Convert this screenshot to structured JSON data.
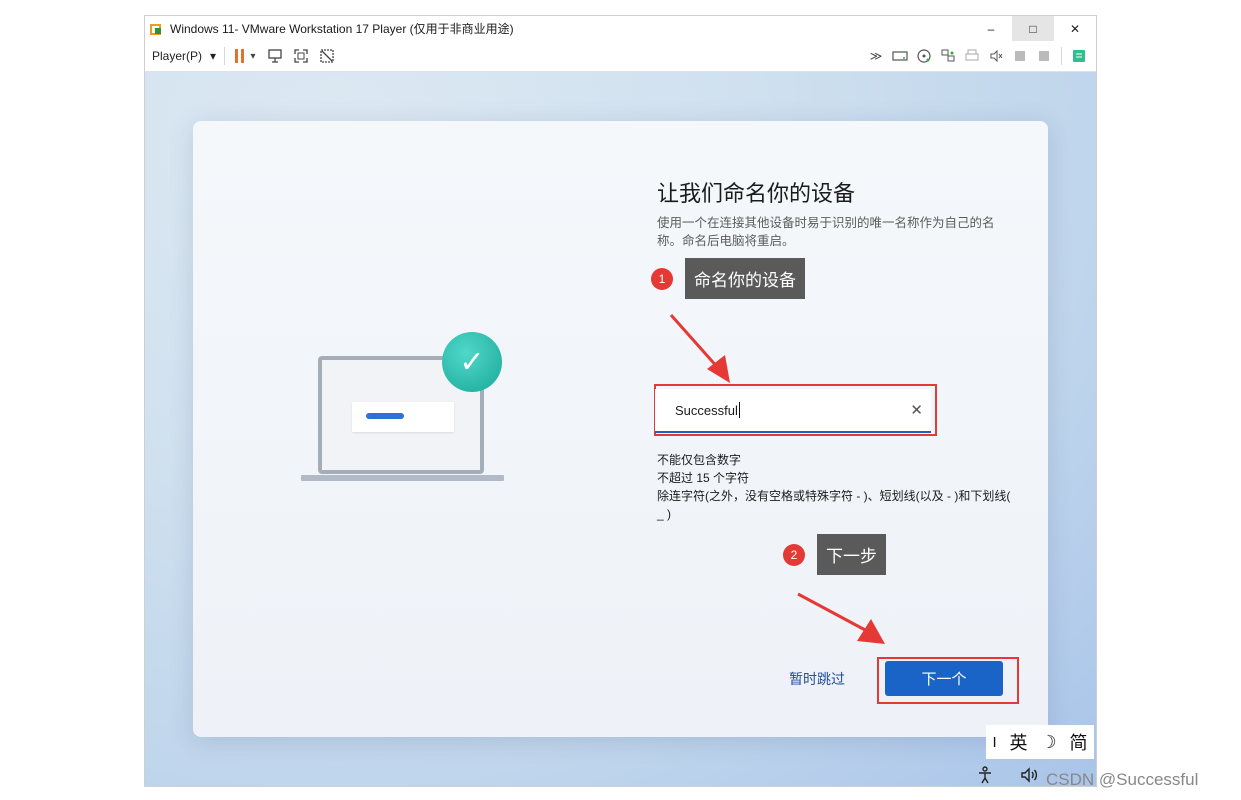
{
  "window": {
    "title": "Windows 11- VMware Workstation 17 Player (仅用于非商业用途)",
    "minimize": "–",
    "maximize": "□",
    "close": "✕"
  },
  "toolbar": {
    "player_menu": "Player(P)",
    "dropdown_glyph": "▾"
  },
  "oobe": {
    "heading": "让我们命名你的设备",
    "description": "使用一个在连接其他设备时易于识别的唯一名称作为自己的名称。命名后电脑将重启。",
    "device_name_value": "Successful",
    "rules": [
      "不能仅包含数字",
      "不超过 15 个字符",
      "除连字符(之外，没有空格或特殊字符 - )、短划线(以及 - )和下划线( _ )"
    ],
    "skip_label": "暂时跳过",
    "next_label": "下一个",
    "clear_glyph": "✕",
    "check_glyph": "✓"
  },
  "callouts": [
    {
      "number": "1",
      "text": "命名你的设备"
    },
    {
      "number": "2",
      "text": "下一步"
    }
  ],
  "ime": {
    "cursor": "I",
    "lang": "英",
    "moon": "☽",
    "mode": "简"
  },
  "watermark": "CSDN @Successful",
  "colors": {
    "accent": "#1a64c8",
    "annotation": "#e53935",
    "callout_bg": "#5a5a5a"
  }
}
